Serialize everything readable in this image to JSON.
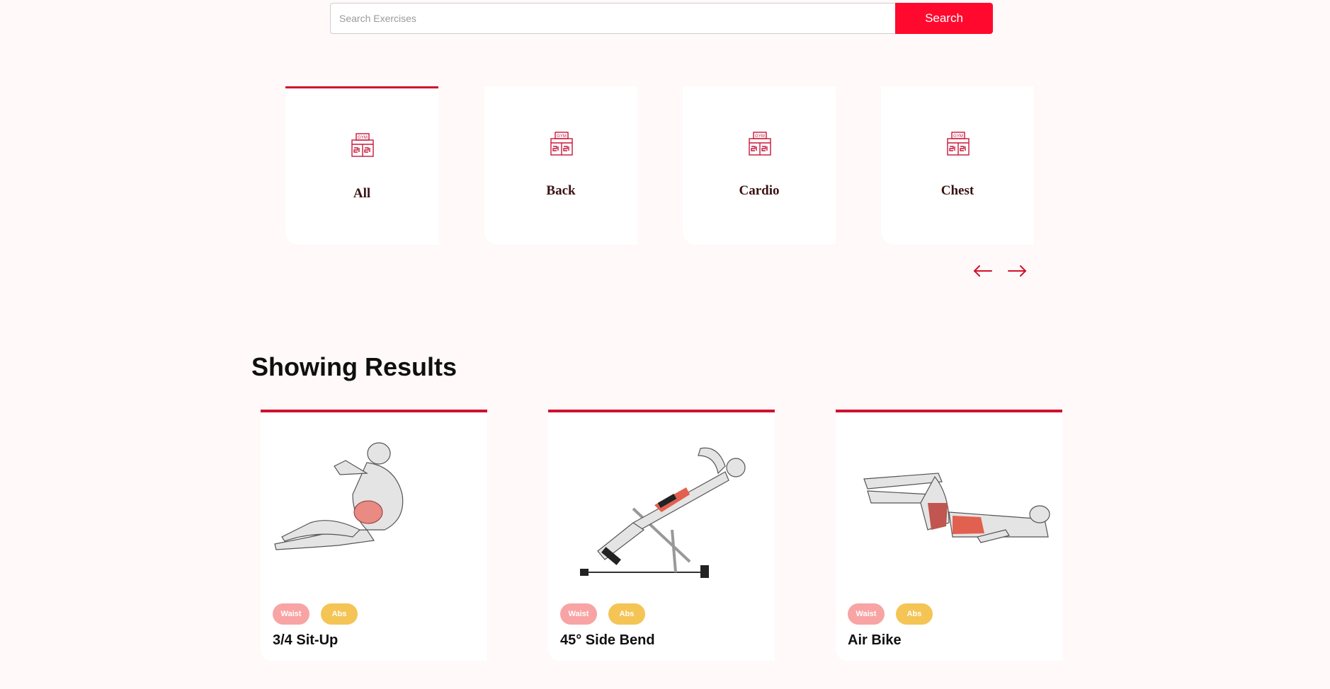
{
  "search": {
    "placeholder": "Search Exercises",
    "value": "",
    "button_label": "Search"
  },
  "colors": {
    "accent": "#ff0a2e",
    "card_border": "#d0102c",
    "waist_tag": "#f8a4a4",
    "abs_tag": "#f4c455"
  },
  "categories": [
    {
      "label": "All",
      "icon": "gym-icon",
      "active": true
    },
    {
      "label": "Back",
      "icon": "gym-icon",
      "active": false
    },
    {
      "label": "Cardio",
      "icon": "gym-icon",
      "active": false
    },
    {
      "label": "Chest",
      "icon": "gym-icon",
      "active": false
    }
  ],
  "carousel": {
    "prev_icon": "arrow-left-icon",
    "next_icon": "arrow-right-icon"
  },
  "results": {
    "title": "Showing Results",
    "items": [
      {
        "name": "3/4 Sit-Up",
        "tags": [
          "Waist",
          "Abs"
        ],
        "image": "sit-up-illustration"
      },
      {
        "name": "45° Side Bend",
        "tags": [
          "Waist",
          "Abs"
        ],
        "image": "side-bend-illustration"
      },
      {
        "name": "Air Bike",
        "tags": [
          "Waist",
          "Abs"
        ],
        "image": "air-bike-illustration"
      }
    ]
  }
}
